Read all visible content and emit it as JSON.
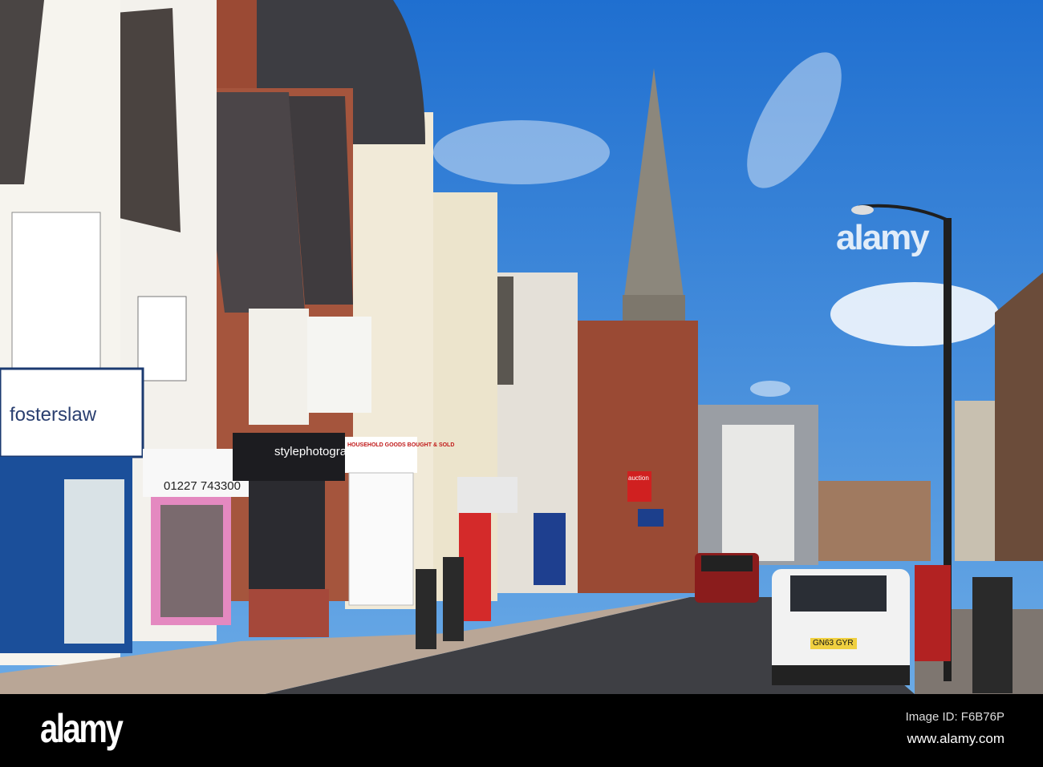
{
  "watermark": {
    "text": "alamy"
  },
  "signs": {
    "fosterslaw": "fosterslaw",
    "phone": "01227 743300",
    "stylephotography": "stylephotography",
    "household": "HOUSEHOLD GOODS BOUGHT & SOLD",
    "auction": "auction",
    "plate": "GN63 GYR"
  },
  "footer": {
    "logo": "alamy",
    "image_id": "Image ID: F6B76P",
    "url": "www.alamy.com"
  },
  "colors": {
    "sky": "#2f7fd6",
    "footer": "#000000"
  }
}
